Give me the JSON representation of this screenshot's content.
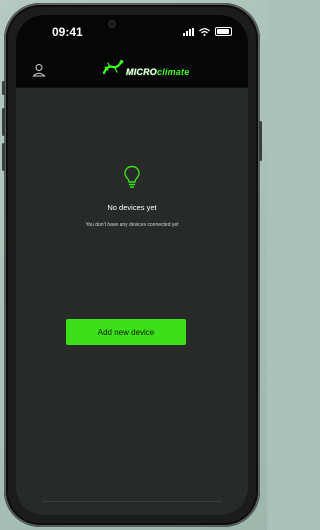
{
  "status_bar": {
    "time": "09:41",
    "icons": [
      "cellular-signal-icon",
      "wifi-icon",
      "battery-icon"
    ]
  },
  "app_bar": {
    "logo_text_part1": "MICRO",
    "logo_text_part2": "climate",
    "left_icon": "user-icon"
  },
  "empty_state": {
    "icon": "lightbulb-icon",
    "title": "No devices yet",
    "subtitle": "You don't have any devices connected yet"
  },
  "actions": {
    "add_device_label": "Add new device"
  },
  "colors": {
    "accent": "#3ddf1a",
    "screen_bg": "#262a29",
    "bar_bg": "#060606",
    "text": "#ffffff"
  }
}
